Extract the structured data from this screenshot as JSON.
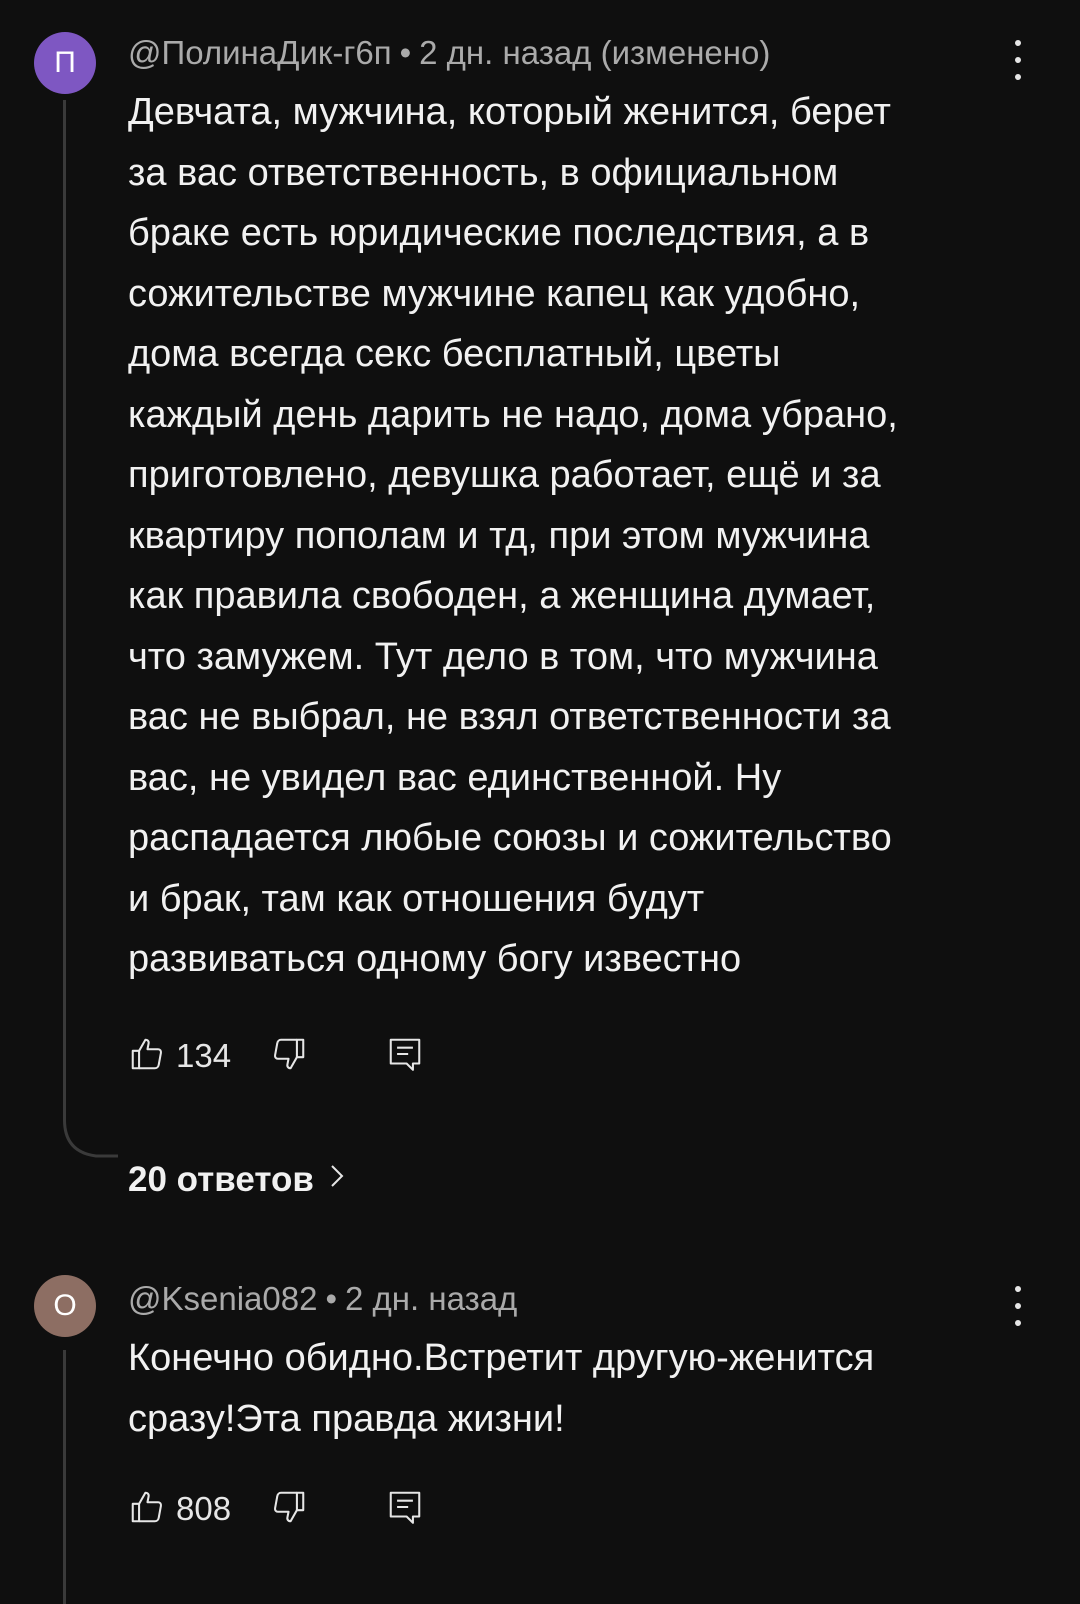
{
  "comments": [
    {
      "avatar_letter": "П",
      "avatar_color": "#7e57c2",
      "author": "@ПолинаДик-г6п",
      "separator": "•",
      "time": "2 дн. назад (изменено)",
      "text": "Девчата, мужчина, который женится, берет\nза вас ответственность, в официальном\nбраке есть юридические последствия, а в\nсожительстве мужчине капец как удобно,\nдома всегда секс бесплатный, цветы\nкаждый день дарить не надо, дома убрано,\nприготовлено, девушка работает, ещё и за\nквартиру пополам и тд, при этом мужчина\nкак правила свободен, а женщина думает,\nчто замужем. Тут дело в том, что мужчина\nвас не выбрал, не взял ответственности за\nвас, не увидел вас единственной. Ну\nраспадается любые союзы и сожительство\nи брак, там как отношения будут\nразвиваться одному богу известно",
      "likes": "134",
      "replies_label": "20 ответов",
      "icons": {
        "like": "thumb-up-icon",
        "dislike": "thumb-down-icon",
        "reply": "reply-icon",
        "menu": "more-vert-icon",
        "chevron": "chevron-right-icon"
      }
    },
    {
      "avatar_letter": "O",
      "avatar_color": "#8d6e63",
      "author": "@Ksenia082",
      "separator": "•",
      "time": "2 дн. назад",
      "text": "Конечно обидно.Встретит другую-женится\nсразу!Эта правда жизни!",
      "likes": "808",
      "icons": {
        "like": "thumb-up-icon",
        "dislike": "thumb-down-icon",
        "reply": "reply-icon",
        "menu": "more-vert-icon"
      }
    }
  ]
}
